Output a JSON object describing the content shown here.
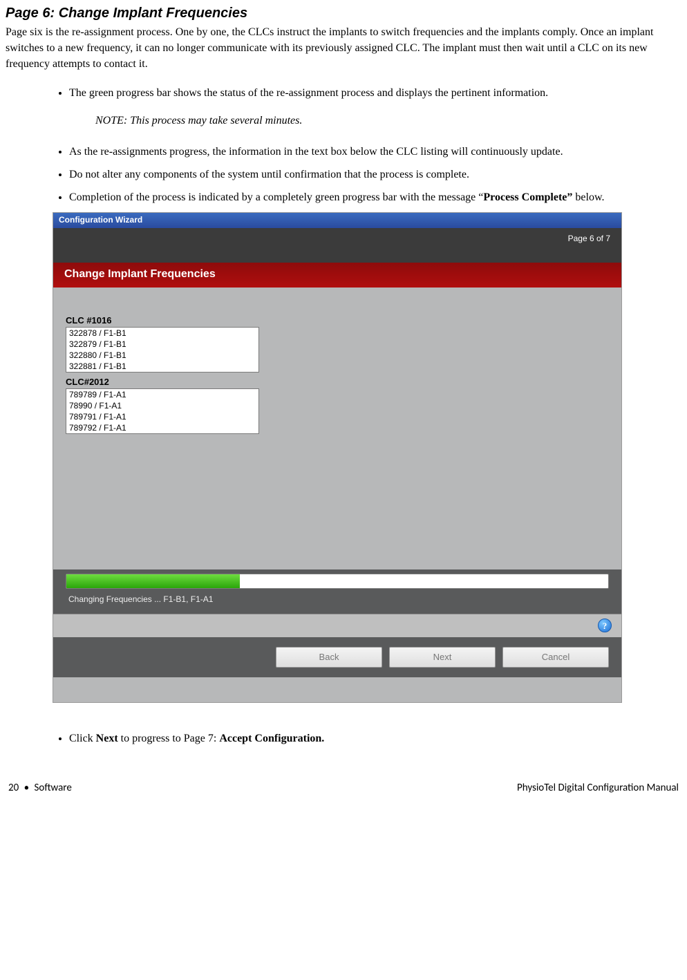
{
  "heading": "Page 6: Change Implant Frequencies",
  "intro": "Page six is the re-assignment process.  One by one, the CLCs instruct the implants to switch frequencies and the implants comply. Once an implant switches to a new frequency, it can no longer communicate with its previously assigned CLC.  The implant must then wait until a CLC on its new frequency attempts to contact it.",
  "bullets1": [
    "The green progress bar shows the status of the re-assignment process and displays the pertinent information."
  ],
  "note": "NOTE: This process may take several minutes.",
  "bullets2": [
    "As the re-assignments progress, the information in the text box below the CLC listing will continuously update.",
    "Do not alter any components of the system until confirmation that the process is complete."
  ],
  "bullet3_prefix": "Completion of the process is indicated by a completely green progress bar with the message “",
  "bullet3_bold": "Process Complete”",
  "bullet3_suffix": " below.",
  "window": {
    "title": "Configuration Wizard",
    "page_indicator": "Page 6 of 7",
    "banner": "Change Implant Frequencies",
    "clc1_label": "CLC #1016",
    "clc1_rows": [
      "322878 / F1-B1",
      "322879 / F1-B1",
      "322880 / F1-B1",
      "322881 / F1-B1"
    ],
    "clc2_label": "CLC#2012",
    "clc2_rows": [
      "789789 / F1-A1",
      "78990 / F1-A1",
      "789791 / F1-A1",
      "789792 / F1-A1"
    ],
    "status": "Changing Frequencies   ...   F1-B1, F1-A1",
    "help_glyph": "?",
    "buttons": {
      "back": "Back",
      "next": "Next",
      "cancel": "Cancel"
    }
  },
  "post_bullet_prefix": "Click ",
  "post_bullet_b1": "Next",
  "post_bullet_mid": " to progress to Page 7: ",
  "post_bullet_b2": "Accept Configuration.",
  "footer": {
    "page_num": "20",
    "dot": "•",
    "section": "Software",
    "doc_title": "PhysioTel Digital Configuration Manual"
  }
}
